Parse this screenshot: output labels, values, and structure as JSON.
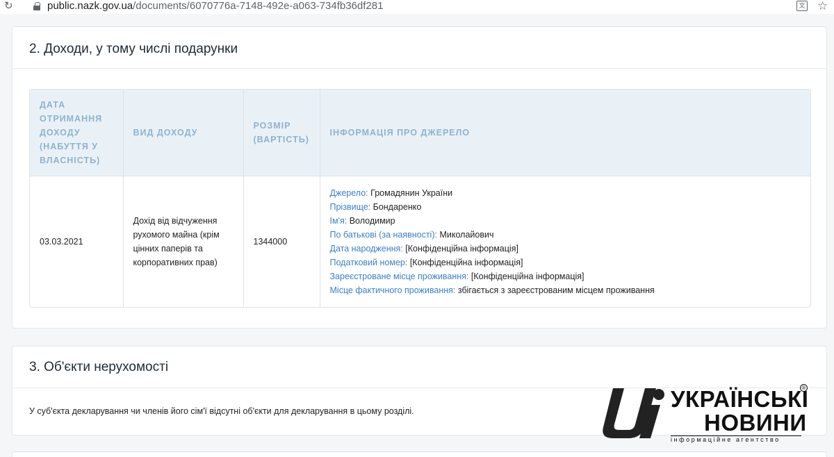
{
  "browser": {
    "url_host": "public.nazk.gov.ua",
    "url_path": "/documents/6070776a-7148-492e-a063-734fb36df281"
  },
  "section2": {
    "title": "2. Доходи, у тому числі подарунки",
    "headers": [
      "ДАТА ОТРИМАННЯ ДОХОДУ (НАБУТТЯ У ВЛАСНІСТЬ)",
      "ВИД ДОХОДУ",
      "РОЗМІР (ВАРТІСТЬ)",
      "ІНФОРМАЦІЯ ПРО ДЖЕРЕЛО"
    ],
    "row": {
      "date": "03.03.2021",
      "type": "Дохід від відчуження рухомого майна (крім цінних паперів та корпоративних прав)",
      "amount": "1344000",
      "source": [
        {
          "label": "Джерело:",
          "value": "Громадянин України"
        },
        {
          "label": "Прізвище:",
          "value": "Бондаренко"
        },
        {
          "label": "Ім'я:",
          "value": "Володимир"
        },
        {
          "label": "По батькові (за наявності):",
          "value": "Миколайович"
        },
        {
          "label": "Дата народження:",
          "value": "[Конфіденційна інформація]"
        },
        {
          "label": "Податковий номер:",
          "value": "[Конфіденційна інформація]"
        },
        {
          "label": "Зареєстроване місце проживання:",
          "value": "[Конфіденційна інформація]"
        },
        {
          "label": "Місце фактичного проживання:",
          "value": "збігається з зареєстрованим місцем проживання"
        }
      ]
    }
  },
  "section3": {
    "title": "3. Об'єкти нерухомості",
    "note": "У суб'єкта декларування чи членів його сім'ї відсутні об'єкти для декларування в цьому розділі."
  },
  "watermark": {
    "line1": "УКРАЇНСЬКІ",
    "line2": "НОВИНИ",
    "tagline": "інформаційне агентство",
    "reg": "®"
  }
}
